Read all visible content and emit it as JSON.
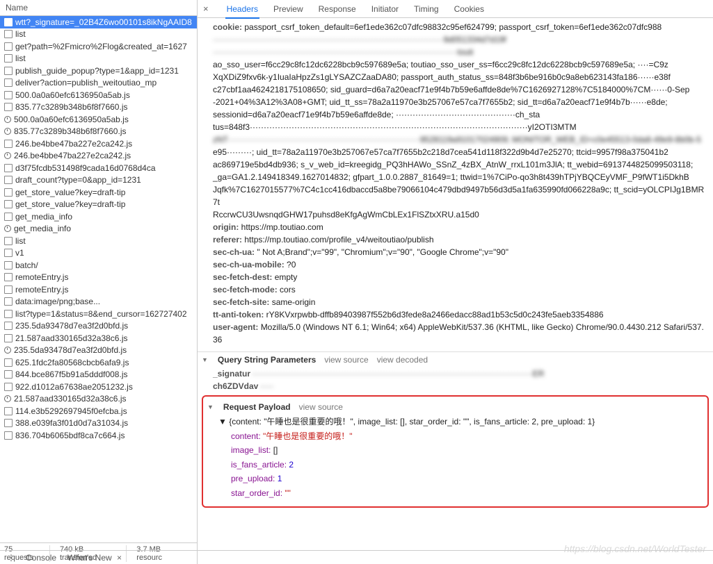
{
  "left": {
    "header": "Name",
    "resources": [
      {
        "name": "wtt?_signature=_02B4Z6wo00101s8ikNgAAID8",
        "icon": "file",
        "selected": true
      },
      {
        "name": "list",
        "icon": "file"
      },
      {
        "name": "get?path=%2Fmicro%2Flog&created_at=1627",
        "icon": "file"
      },
      {
        "name": "list",
        "icon": "file"
      },
      {
        "name": "publish_guide_popup?type=1&app_id=1231",
        "icon": "file"
      },
      {
        "name": "deliver?action=publish_weitoutiao_mp",
        "icon": "file"
      },
      {
        "name": "500.0a0a60efc6136950a5ab.js",
        "icon": "file"
      },
      {
        "name": "835.77c3289b348b6f8f7660.js",
        "icon": "file"
      },
      {
        "name": "500.0a0a60efc6136950a5ab.js",
        "icon": "clock"
      },
      {
        "name": "835.77c3289b348b6f8f7660.js",
        "icon": "clock"
      },
      {
        "name": "246.be4bbe47ba227e2ca242.js",
        "icon": "file"
      },
      {
        "name": "246.be4bbe47ba227e2ca242.js",
        "icon": "clock"
      },
      {
        "name": "d3f75fcdb531498f9cada16d0768d4ca",
        "icon": "file"
      },
      {
        "name": "draft_count?type=0&app_id=1231",
        "icon": "file"
      },
      {
        "name": "get_store_value?key=draft-tip",
        "icon": "file"
      },
      {
        "name": "get_store_value?key=draft-tip",
        "icon": "file"
      },
      {
        "name": "get_media_info",
        "icon": "file"
      },
      {
        "name": "get_media_info",
        "icon": "clock"
      },
      {
        "name": "list",
        "icon": "file"
      },
      {
        "name": "v1",
        "icon": "file"
      },
      {
        "name": "batch/",
        "icon": "file"
      },
      {
        "name": "remoteEntry.js",
        "icon": "file"
      },
      {
        "name": "remoteEntry.js",
        "icon": "file"
      },
      {
        "name": "data:image/png;base...",
        "icon": "file"
      },
      {
        "name": "list?type=1&status=8&end_cursor=162727402",
        "icon": "file"
      },
      {
        "name": "235.5da93478d7ea3f2d0bfd.js",
        "icon": "file"
      },
      {
        "name": "21.587aad330165d32a38c6.js",
        "icon": "file"
      },
      {
        "name": "235.5da93478d7ea3f2d0bfd.js",
        "icon": "clock"
      },
      {
        "name": "625.1fdc2fa80568cbcb6afa9.js",
        "icon": "file"
      },
      {
        "name": "844.bce867f5b91a5dddf008.js",
        "icon": "file"
      },
      {
        "name": "922.d1012a67638ae2051232.js",
        "icon": "file"
      },
      {
        "name": "21.587aad330165d32a38c6.js",
        "icon": "clock"
      },
      {
        "name": "114.e3b5292697945f0efcba.js",
        "icon": "file"
      },
      {
        "name": "388.e039fa3f01d0d7a31034.js",
        "icon": "file"
      },
      {
        "name": "836.704b6065bdf8ca7c664.js",
        "icon": "file"
      }
    ],
    "footer": {
      "requests": "75 requests",
      "transferred": "740 kB transferred",
      "resources": "3.7 MB resourc"
    }
  },
  "tabs": [
    "Headers",
    "Preview",
    "Response",
    "Initiator",
    "Timing",
    "Cookies"
  ],
  "active_tab": 0,
  "headers_block": {
    "cookie_key": "cookie:",
    "cookie_val": "passport_csrf_token_default=6ef1ede362c07dfc98832c95ef624799; passport_csrf_token=6ef1ede362c07dfc988",
    "blur1": "···················································································9d051334d7d19f",
    "blur2": "························································································touti",
    "line3": "ao_sso_user=f6cc29c8fc12dc6228bcb9c597689e5a; toutiao_sso_user_ss=f6cc29c8fc12dc6228bcb9c597689e5a; ····=C9z",
    "line4": "XqXDiZ9fxv6k-y1IuaIaHpzZs1gLYSAZCZaaDA80; passport_auth_status_ss=848f3b6be916b0c9a8eb623143fa186······e38f",
    "line5": "c27cbf1aa4624218175108650; sid_guard=d6a7a20eacf71e9f4b7b59e6affde8de%7C1626927128%7C5184000%7CM······0-Sep",
    "line6": "-2021+04%3A12%3A08+GMT; uid_tt_ss=78a2a11970e3b257067e57ca7f7655b2; sid_tt=d6a7a20eacf71e9f4b7b······e8de;",
    "line7": "sessionid=d6a7a20eacf71e9f4b7b59e6affde8de; ···········································ch_sta",
    "line8": "tus=848f3····································································································yI2OTI3MTM",
    "blur3": "zNT·····································································9528119a91017024909; MONITOR_WEB_ID=c0e45513-0da8-49e9-8b0b-5",
    "line9": "e95·········; uid_tt=78a2a11970e3b257067e57ca7f7655b2c218d7cea541d118f322d9b4d7e25270; ttcid=9957f98a375041b2",
    "line10": "ac869719e5bd4db936; s_v_web_id=kreegidg_PQ3hHAWo_SSnZ_4zBX_AtnW_rrxL101m3JlA; tt_webid=6913744825099503118;",
    "line11": "_ga=GA1.2.149418349.1627014832; gfpart_1.0.0.2887_81649=1; ttwid=1%7CiPo-qo3h8t439hTPjYBQCEyVMF_P9fWT1i5DkhB",
    "line12": "Jqfk%7C1627015577%7C4c1cc416dbaccd5a8be79066104c479dbd9497b56d3d5a1fa635990fd066228a9c; tt_scid=yOLCPIJg1BMR7t",
    "line13": "RccrwCU3UwsnqdGHW17puhsd8eKfgAgWmCbLEx1FlSZtxXRU.a15d0",
    "rows": [
      {
        "k": "origin:",
        "v": "https://mp.toutiao.com"
      },
      {
        "k": "referer:",
        "v": "https://mp.toutiao.com/profile_v4/weitoutiao/publish"
      },
      {
        "k": "sec-ch-ua:",
        "v": "\" Not A;Brand\";v=\"99\", \"Chromium\";v=\"90\", \"Google Chrome\";v=\"90\""
      },
      {
        "k": "sec-ch-ua-mobile:",
        "v": "?0"
      },
      {
        "k": "sec-fetch-dest:",
        "v": "empty"
      },
      {
        "k": "sec-fetch-mode:",
        "v": "cors"
      },
      {
        "k": "sec-fetch-site:",
        "v": "same-origin"
      },
      {
        "k": "tt-anti-token:",
        "v": "rY8KVxrpwbb-dffb89403987f552b6d3fede8a2466edacc88ad1b53c5d0c243fe5aeb3354886"
      },
      {
        "k": "user-agent:",
        "v": "Mozilla/5.0 (Windows NT 6.1; Win64; x64) AppleWebKit/537.36 (KHTML, like Gecko) Chrome/90.0.4430.212 Safari/537.36"
      }
    ]
  },
  "query": {
    "title": "Query String Parameters",
    "view_source": "view source",
    "view_decoded": "view decoded",
    "params": [
      {
        "k": "_signatur",
        "v": "·····································································································ER",
        "blur": true
      },
      {
        "k": "ch6ZDVdav",
        "v": "·····",
        "blur": true
      }
    ]
  },
  "payload": {
    "title": "Request Payload",
    "view_source": "view source",
    "summary": "{content: \"午睡也是很重要的哦！\", image_list: [], star_order_id: \"\", is_fans_article: 2, pre_upload: 1}",
    "rows": [
      {
        "k": "content:",
        "v": "\"午睡也是很重要的哦！\"",
        "cls": "json-str"
      },
      {
        "k": "image_list:",
        "v": "[]",
        "cls": "json-plain"
      },
      {
        "k": "is_fans_article:",
        "v": "2",
        "cls": "json-num"
      },
      {
        "k": "pre_upload:",
        "v": "1",
        "cls": "json-num"
      },
      {
        "k": "star_order_id:",
        "v": "\"\"",
        "cls": "json-str"
      }
    ]
  },
  "watermark": "https://blog.csdn.net/WorldTester",
  "bottom": {
    "console": "Console",
    "whatsnew": "What's New"
  }
}
